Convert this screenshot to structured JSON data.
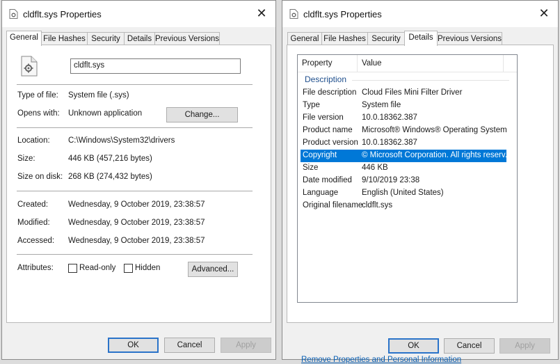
{
  "general_window": {
    "title": "cldflt.sys Properties",
    "tabs": [
      "General",
      "File Hashes",
      "Security",
      "Details",
      "Previous Versions"
    ],
    "filename": "cldflt.sys",
    "type_label": "Type of file:",
    "type_value": "System file (.sys)",
    "opens_label": "Opens with:",
    "opens_value": "Unknown application",
    "change_button": "Change...",
    "location_label": "Location:",
    "location_value": "C:\\Windows\\System32\\drivers",
    "size_label": "Size:",
    "size_value": "446 KB (457,216 bytes)",
    "size_disk_label": "Size on disk:",
    "size_disk_value": "268 KB (274,432 bytes)",
    "created_label": "Created:",
    "created_value": "Wednesday, 9 October 2019, 23:38:57",
    "modified_label": "Modified:",
    "modified_value": "Wednesday, 9 October 2019, 23:38:57",
    "accessed_label": "Accessed:",
    "accessed_value": "Wednesday, 9 October 2019, 23:38:57",
    "attributes_label": "Attributes:",
    "readonly_label": "Read-only",
    "hidden_label": "Hidden",
    "advanced_button": "Advanced...",
    "ok": "OK",
    "cancel": "Cancel",
    "apply": "Apply"
  },
  "details_window": {
    "title": "cldflt.sys Properties",
    "tabs": [
      "General",
      "File Hashes",
      "Security",
      "Details",
      "Previous Versions"
    ],
    "col_property": "Property",
    "col_value": "Value",
    "group": "Description",
    "rows": [
      {
        "k": "File description",
        "v": "Cloud Files Mini Filter Driver"
      },
      {
        "k": "Type",
        "v": "System file"
      },
      {
        "k": "File version",
        "v": "10.0.18362.387"
      },
      {
        "k": "Product name",
        "v": "Microsoft® Windows® Operating System"
      },
      {
        "k": "Product version",
        "v": "10.0.18362.387"
      },
      {
        "k": "Copyright",
        "v": "© Microsoft Corporation. All rights reserv..."
      },
      {
        "k": "Size",
        "v": "446 KB"
      },
      {
        "k": "Date modified",
        "v": "9/10/2019 23:38"
      },
      {
        "k": "Language",
        "v": "English (United States)"
      },
      {
        "k": "Original filename",
        "v": "cldflt.sys"
      }
    ],
    "remove_link": "Remove Properties and Personal Information",
    "ok": "OK",
    "cancel": "Cancel",
    "apply": "Apply"
  },
  "colors": {
    "selection": "#0078d7",
    "link": "#0a5fb3",
    "focus_border": "#2a73c9"
  },
  "icons": [
    "document-gear-icon",
    "close-icon"
  ]
}
